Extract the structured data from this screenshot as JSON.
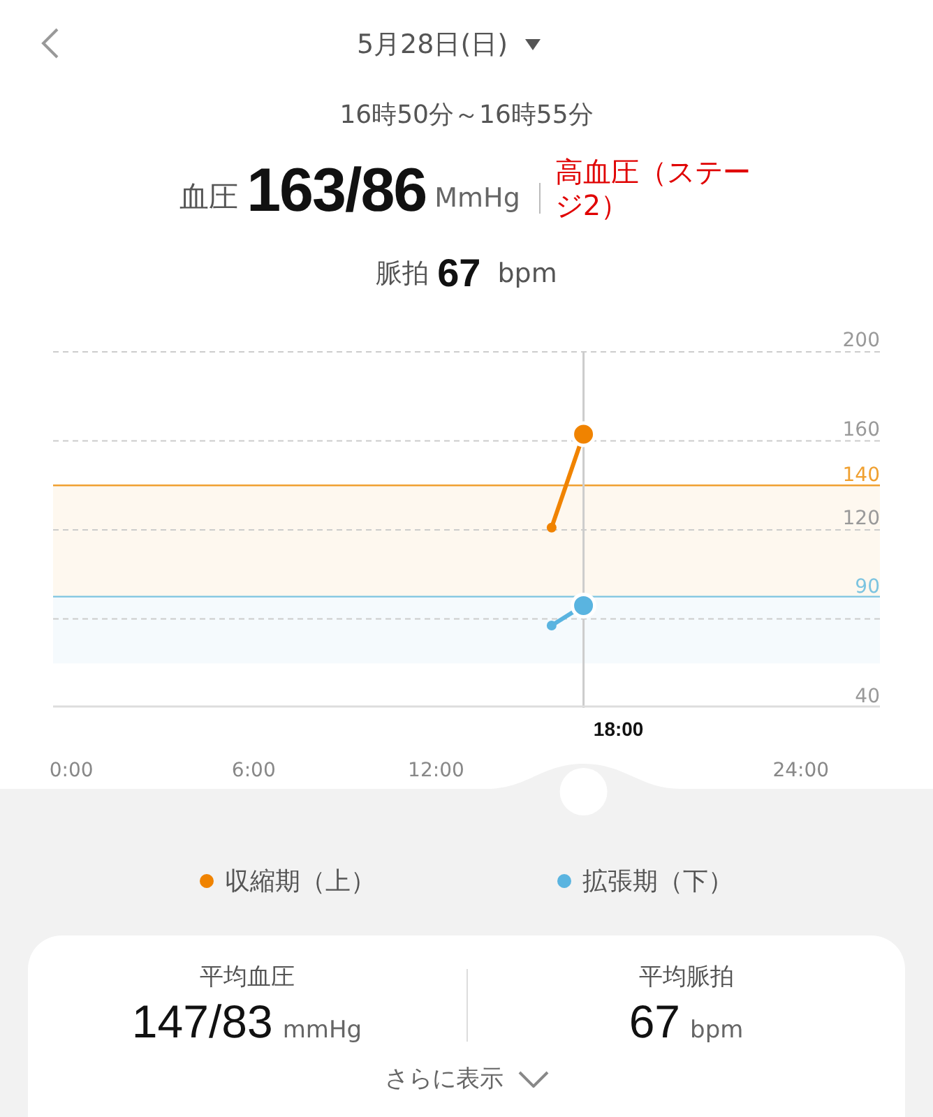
{
  "date_title": "5月28日(日)",
  "time_range": "16時50分～16時55分",
  "blood_pressure": {
    "label": "血圧",
    "value": "163/86",
    "unit": "MmHg",
    "status": "高血圧（ステージ2）"
  },
  "pulse": {
    "label": "脈拍",
    "value": "67",
    "unit": "bpm"
  },
  "chart": {
    "cursor_label": "18:00",
    "chart_data": {
      "type": "line",
      "x": [
        15.8,
        16.85
      ],
      "series": [
        {
          "name": "収縮期（上）",
          "color": "#f08300",
          "marker": "circle",
          "values": [
            121,
            163
          ]
        },
        {
          "name": "拡張期（下）",
          "color": "#5ab4e0",
          "marker": "circle",
          "values": [
            77,
            86
          ]
        }
      ],
      "xlim": [
        -0.6,
        26.6
      ],
      "ylim": [
        40,
        200
      ],
      "yticks": [
        40,
        120,
        160,
        200
      ],
      "xticks": [
        {
          "value": 0,
          "label": "0:00"
        },
        {
          "value": 6,
          "label": "6:00"
        },
        {
          "value": 12,
          "label": "12:00"
        },
        {
          "value": 24,
          "label": "24:00"
        }
      ],
      "ref_lines": [
        {
          "axis": "y",
          "value": 140,
          "label": "140",
          "color": "#f0a030"
        },
        {
          "axis": "y",
          "value": 90,
          "label": "90",
          "color": "#7cc4e0"
        },
        {
          "axis": "x",
          "value": 16.85,
          "color": "#cccccc"
        }
      ],
      "bands": [
        {
          "axis": "y",
          "from": 90,
          "to": 140,
          "color": "#f0a030"
        },
        {
          "axis": "y",
          "from": 60,
          "to": 90,
          "color": "#7cc4e0"
        }
      ]
    }
  },
  "summary": {
    "items": [
      {
        "label": "平均血圧",
        "value": "147/83",
        "unit": "mmHg"
      },
      {
        "label": "平均脈拍",
        "value": "67",
        "unit": "bpm"
      }
    ],
    "more_label": "さらに表示"
  }
}
